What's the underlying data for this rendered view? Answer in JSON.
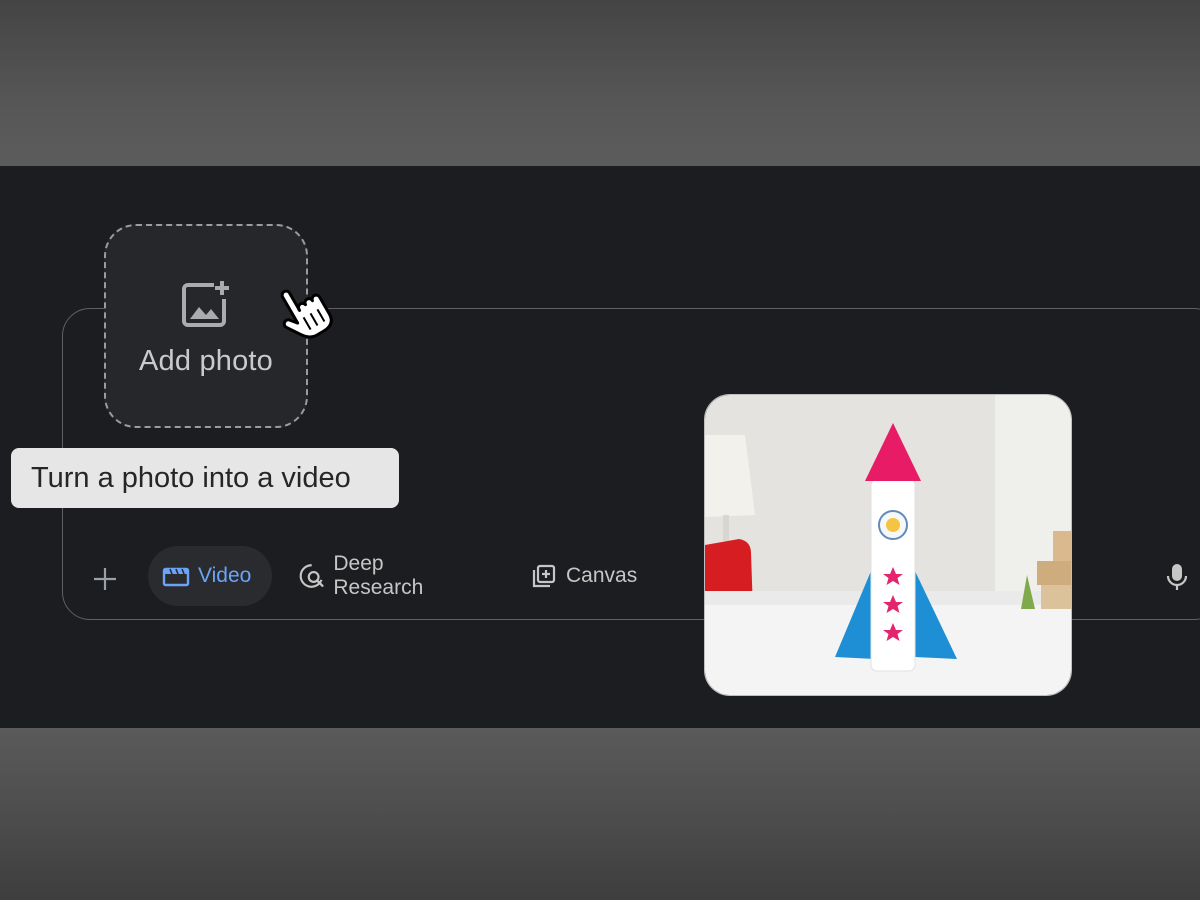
{
  "add_photo": {
    "label": "Add photo",
    "icon": "add-image-icon"
  },
  "tooltip": {
    "text": "Turn a photo into a video"
  },
  "toolbar": {
    "plus_icon": "plus-icon",
    "tools": [
      {
        "label": "Video",
        "icon": "video-icon",
        "active": true
      },
      {
        "label": "Deep Research",
        "icon": "deep-research-icon",
        "active": false
      },
      {
        "label": "Canvas",
        "icon": "canvas-icon",
        "active": false
      }
    ],
    "mic_icon": "mic-icon"
  },
  "preview": {
    "subject": "paper-rocket-photo"
  },
  "colors": {
    "active_accent": "#6ba4f7",
    "background": "#1c1d20",
    "tooltip_bg": "#e6e6e6"
  }
}
